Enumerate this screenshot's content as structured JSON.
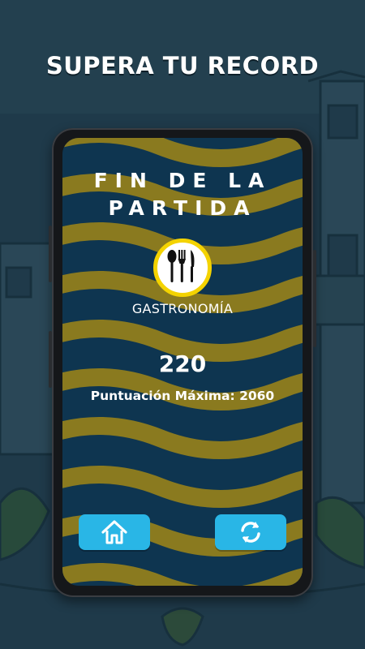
{
  "promo": {
    "headline": "SUPERA TU RECORD"
  },
  "game_over": {
    "title_line1": "FIN DE LA",
    "title_line2": "PARTIDA",
    "category": {
      "label": "GASTRONOMÍA",
      "icon": "cutlery-icon"
    },
    "score": "220",
    "best_score_label": "Puntuación Máxima: 2060"
  },
  "buttons": {
    "home": {
      "icon": "home-icon"
    },
    "replay": {
      "icon": "refresh-icon"
    }
  },
  "colors": {
    "navy": "#0e3550",
    "wave": "#8a7a1f",
    "accent_button": "#29b6e6",
    "icon_ring": "#f4d300"
  }
}
